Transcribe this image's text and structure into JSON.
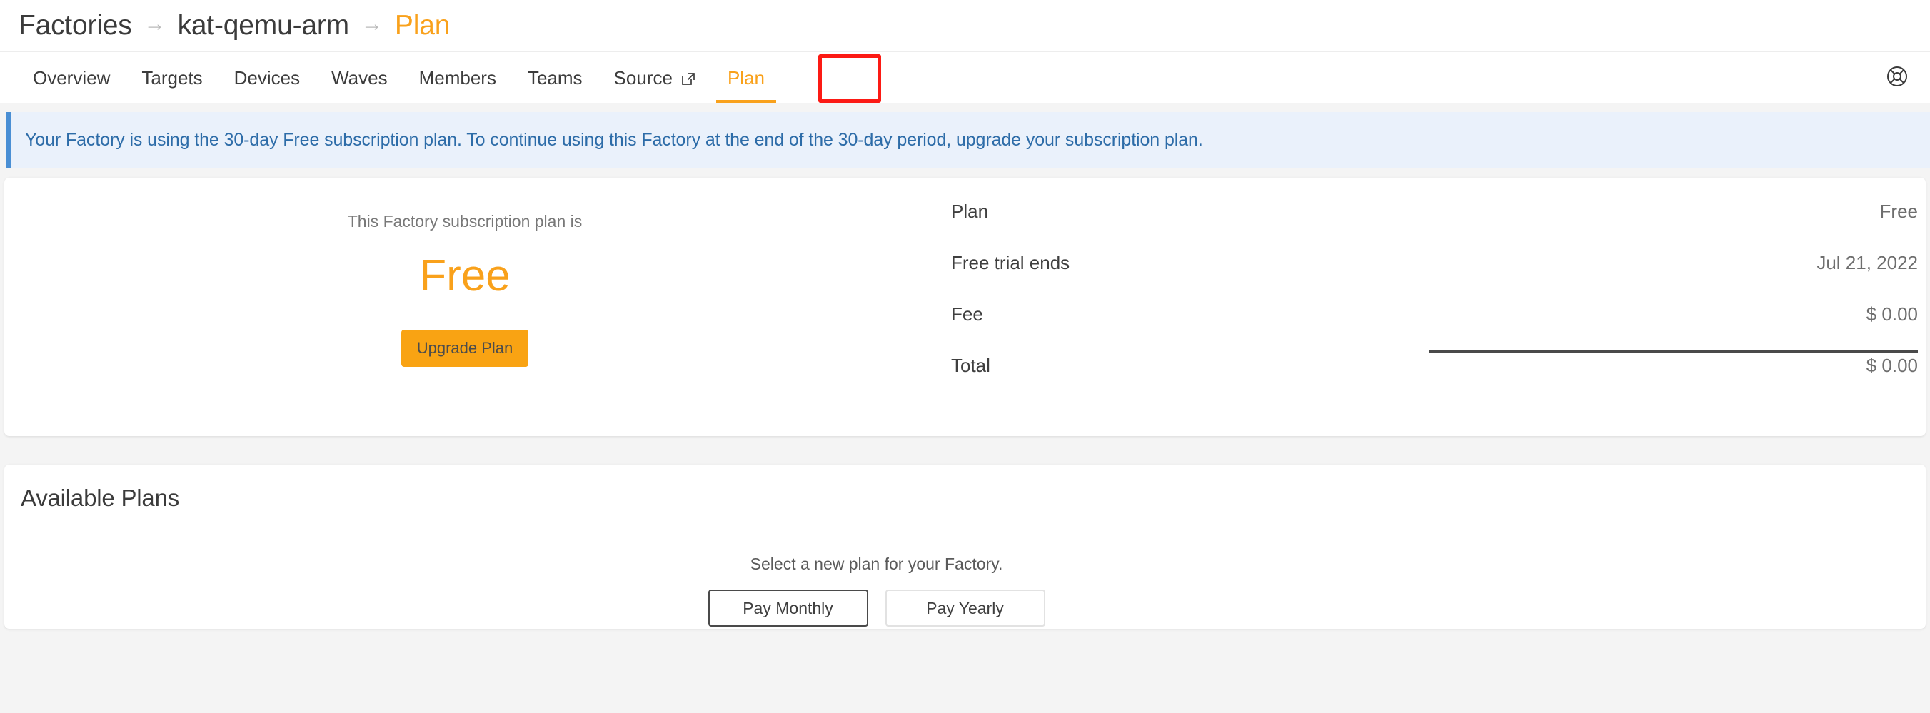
{
  "breadcrumb": {
    "separator": "→",
    "items": [
      {
        "label": "Factories",
        "active": false
      },
      {
        "label": "kat-qemu-arm",
        "active": false
      },
      {
        "label": "Plan",
        "active": true
      }
    ]
  },
  "tabs": {
    "items": [
      {
        "label": "Overview"
      },
      {
        "label": "Targets"
      },
      {
        "label": "Devices"
      },
      {
        "label": "Waves"
      },
      {
        "label": "Members"
      },
      {
        "label": "Teams"
      },
      {
        "label": "Source",
        "icon": "external-link-icon"
      },
      {
        "label": "Plan",
        "active": true
      }
    ],
    "help_icon": "lifebuoy-help-icon",
    "highlight_color": "#fc1a14",
    "active_color": "#f9a11b"
  },
  "banner": {
    "text": "Your Factory is using the 30-day Free subscription plan. To continue using this Factory at the end of the 30-day period, upgrade your subscription plan.",
    "accent_color": "#4a8fd4",
    "background_color": "#eaf1fb"
  },
  "summary": {
    "caption": "This Factory subscription plan is",
    "plan_name": "Free",
    "plan_name_color": "#f9a11b",
    "upgrade_button": "Upgrade Plan",
    "upgrade_button_color": "#f9a313",
    "details": [
      {
        "label": "Plan",
        "value": "Free"
      },
      {
        "label": "Free trial ends",
        "value": "Jul 21, 2022"
      },
      {
        "label": "Fee",
        "value": "$ 0.00"
      },
      {
        "label": "Total",
        "value": "$ 0.00"
      }
    ]
  },
  "available_plans": {
    "title": "Available Plans",
    "subtitle": "Select a new plan for your Factory.",
    "billing_options": [
      {
        "label": "Pay Monthly",
        "selected": true
      },
      {
        "label": "Pay Yearly",
        "selected": false
      }
    ]
  }
}
